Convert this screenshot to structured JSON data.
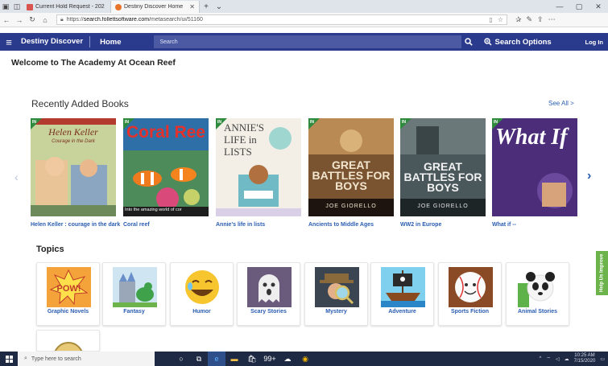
{
  "browser": {
    "tabs": [
      {
        "title": "Current Hold Request - 202",
        "active": false
      },
      {
        "title": "Destiny Discover Home",
        "active": true
      }
    ],
    "url_prefix": "https://",
    "url_host": "search.follettsoftware.com",
    "url_path": "/metasearch/ui/51160"
  },
  "header": {
    "brand": "Destiny Discover",
    "home": "Home",
    "search_placeholder": "Search",
    "search_options": "Search Options",
    "login": "Log In"
  },
  "welcome": "Welcome to The Academy At Ocean Reef",
  "recent": {
    "title": "Recently Added Books",
    "see_all": "See All >",
    "badge": "IN",
    "books": [
      {
        "title": "Helen Keller : courage in the dark",
        "cover_text": "Helen Keller",
        "cover_sub": "Courage in the Dark",
        "bg": "#b9c88e"
      },
      {
        "title": "Coral reef",
        "cover_text": "Coral Ree",
        "cover_sub": "Into the amazing world of cor",
        "bg": "#3a7fb5"
      },
      {
        "title": "Annie's life in lists",
        "cover_text": "ANNIE'S LIFE in LISTS",
        "cover_sub": "",
        "bg": "#f1eee6"
      },
      {
        "title": "Ancients to Middle Ages",
        "cover_text": "GREAT BATTLES FOR BOYS",
        "cover_sub": "JOE GIORELLO",
        "bg": "#6b4a2a"
      },
      {
        "title": "WW2 in Europe",
        "cover_text": "GREAT BATTLES FOR BOYS",
        "cover_sub": "JOE GIORELLO",
        "bg": "#3d4a4f"
      },
      {
        "title": "What if --",
        "cover_text": "What If",
        "cover_sub": "",
        "bg": "#4b2d7a"
      }
    ]
  },
  "topics": {
    "title": "Topics",
    "items": [
      {
        "label": "Graphic Novels",
        "icon": "pow-comic-icon"
      },
      {
        "label": "Fantasy",
        "icon": "castle-dragon-icon"
      },
      {
        "label": "Humor",
        "icon": "laughing-emoji-icon"
      },
      {
        "label": "Scary Stories",
        "icon": "ghost-icon"
      },
      {
        "label": "Mystery",
        "icon": "detective-icon"
      },
      {
        "label": "Adventure",
        "icon": "pirate-ship-icon"
      },
      {
        "label": "Sports Fiction",
        "icon": "baseball-icon"
      },
      {
        "label": "Animal Stories",
        "icon": "panda-icon"
      }
    ]
  },
  "help_tab": "Help Us Improve",
  "taskbar": {
    "search_placeholder": "Type here to search",
    "badge_count": "99+",
    "time": "10:25 AM",
    "date": "7/15/2020"
  },
  "colors": {
    "header_bg": "#2a3a8c",
    "link": "#2a5db0",
    "badge_green": "#2e8b3d",
    "help_green": "#6bb34a"
  }
}
